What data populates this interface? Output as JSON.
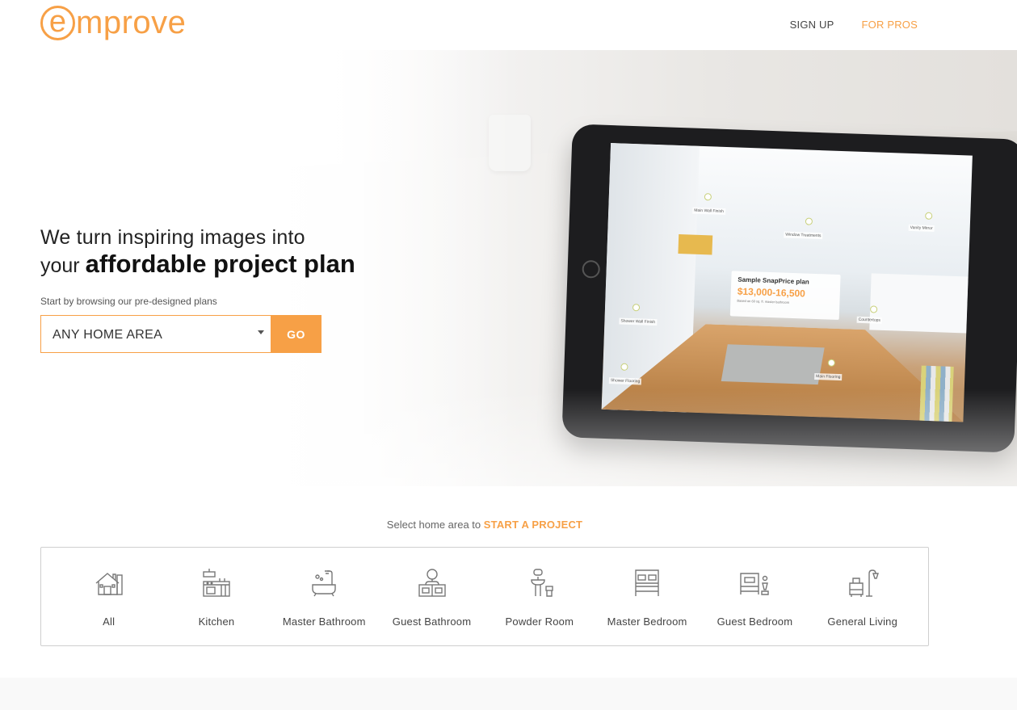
{
  "header": {
    "logo_e": "e",
    "logo_rest": "mprove",
    "nav": {
      "sign_up": "SIGN UP",
      "for_pros": "FOR PROS"
    }
  },
  "hero": {
    "headline_line1": "We turn inspiring images into",
    "headline_line2_prefix": "your",
    "headline_line2_bold": "affordable project plan",
    "subtext": "Start by browsing our pre-designed plans",
    "select_value": "ANY HOME AREA",
    "go_label": "GO",
    "tablet": {
      "card_title": "Sample SnapPrice plan",
      "card_price": "$13,000-16,500",
      "card_note": "Based on 60 sq. ft. master bathroom",
      "tags": [
        "Main Wall Finish",
        "Window Treatments",
        "Vanity Mirror",
        "Shower Wall Finish",
        "Countertops",
        "Shower Flooring",
        "Main Flooring"
      ]
    }
  },
  "areas_section": {
    "prompt_prefix": "Select home area to",
    "prompt_highlight": "START A PROJECT",
    "items": [
      {
        "label": "All",
        "icon": "house-icon"
      },
      {
        "label": "Kitchen",
        "icon": "kitchen-icon"
      },
      {
        "label": "Master Bathroom",
        "icon": "bathtub-icon"
      },
      {
        "label": "Guest Bathroom",
        "icon": "vanity-sink-icon"
      },
      {
        "label": "Powder Room",
        "icon": "pedestal-sink-icon"
      },
      {
        "label": "Master Bedroom",
        "icon": "double-bed-icon"
      },
      {
        "label": "Guest Bedroom",
        "icon": "single-bed-icon"
      },
      {
        "label": "General Living",
        "icon": "sofa-lamp-icon"
      }
    ]
  },
  "colors": {
    "accent": "#f7a046",
    "text": "#333333",
    "border": "#cfcfcf"
  }
}
